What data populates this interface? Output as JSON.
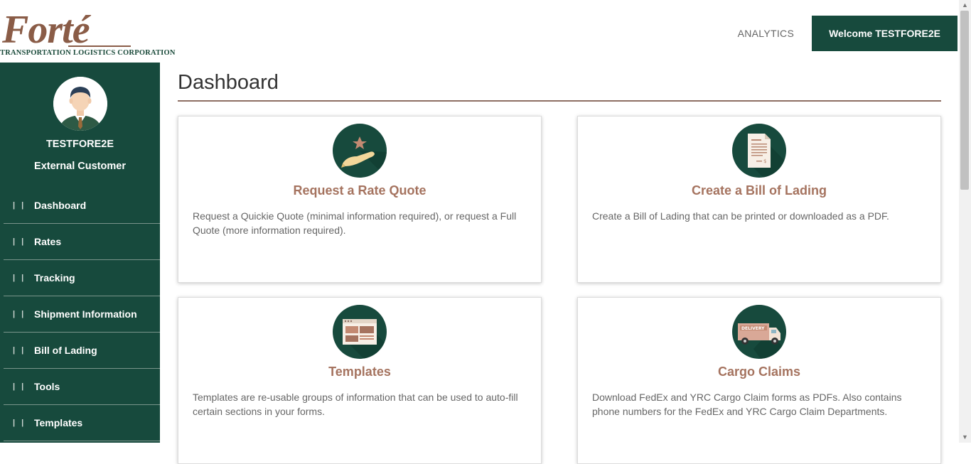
{
  "brand": {
    "name": "Forté",
    "tagline": "TRANSPORTATION LOGISTICS CORPORATION"
  },
  "topnav": {
    "icon_glyph": "",
    "analytics_label": "ANALYTICS",
    "welcome_label": "Welcome TESTFORE2E",
    "welcome_icon_left": "",
    "welcome_icon_right": ""
  },
  "user": {
    "name": "TESTFORE2E",
    "role": "External Customer"
  },
  "sidebar": {
    "items": [
      {
        "label": "Dashboard",
        "bars": "| |",
        "arrow": ""
      },
      {
        "label": "Rates",
        "bars": "| |",
        "arrow": ""
      },
      {
        "label": "Tracking",
        "bars": "| |",
        "arrow": ""
      },
      {
        "label": "Shipment Information",
        "bars": "| |",
        "arrow": ""
      },
      {
        "label": "Bill of Lading",
        "bars": "| |",
        "arrow": ""
      },
      {
        "label": "Tools",
        "bars": "| |",
        "arrow": ""
      },
      {
        "label": "Templates",
        "bars": "| |",
        "arrow": ""
      }
    ]
  },
  "page": {
    "title": "Dashboard"
  },
  "cards": [
    {
      "icon": "hand-star-icon",
      "title": "Request a Rate Quote",
      "description": "Request a Quickie Quote (minimal information required), or request a Full Quote (more information required)."
    },
    {
      "icon": "bill-of-lading-document-icon",
      "title": "Create a Bill of Lading",
      "description": "Create a Bill of Lading that can be printed or downloaded as a PDF."
    },
    {
      "icon": "template-layout-icon",
      "title": "Templates",
      "description": "Templates are re-usable groups of information that can be used to auto-fill certain sections in your forms."
    },
    {
      "icon": "delivery-truck-icon",
      "title": "Cargo Claims",
      "description": "Download FedEx and YRC Cargo Claim forms as PDFs. Also contains phone numbers for the FedEx and YRC Cargo Claim Departments."
    }
  ],
  "colors": {
    "primary_green": "#174a3d",
    "accent_brown": "#a5735f",
    "rule_brown": "#8d6e63"
  }
}
